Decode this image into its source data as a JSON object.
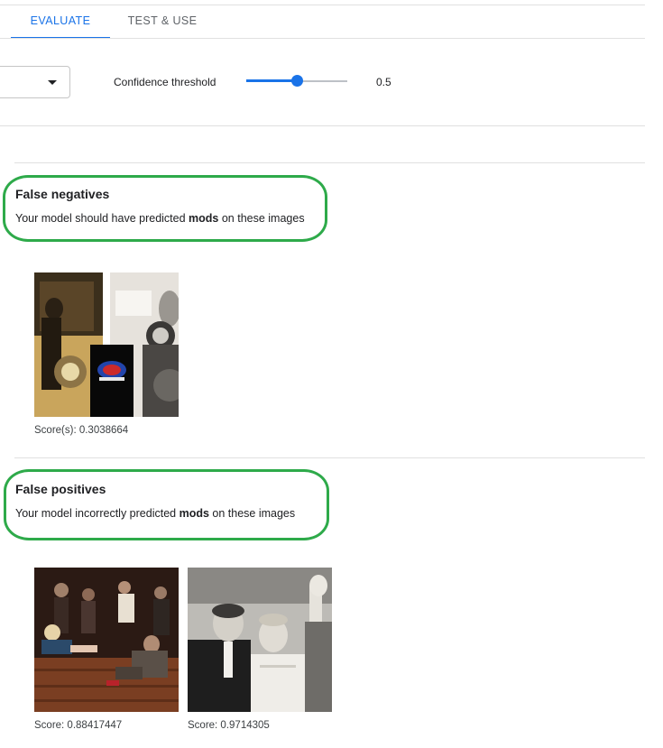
{
  "tabs": {
    "evaluate": "EVALUATE",
    "test_use": "TEST & USE"
  },
  "controls": {
    "threshold_label": "Confidence threshold",
    "threshold_value": "0.5",
    "threshold_fraction": 0.5,
    "dropdown_icon": "caret-down-icon"
  },
  "false_negatives": {
    "title": "False negatives",
    "desc_prefix": "Your model should have predicted ",
    "desc_label": "mods",
    "desc_suffix": " on these images",
    "images": [
      {
        "score": "Score(s): 0.3038664"
      }
    ]
  },
  "false_positives": {
    "title": "False positives",
    "desc_prefix": "Your model incorrectly predicted ",
    "desc_label": "mods",
    "desc_suffix": " on these images",
    "images": [
      {
        "score": "Score: 0.88417447"
      },
      {
        "score": "Score: 0.9714305"
      }
    ]
  },
  "colors": {
    "accent": "#1a73e8",
    "highlight": "#2eaa4a",
    "divider": "#e0e0e0"
  }
}
